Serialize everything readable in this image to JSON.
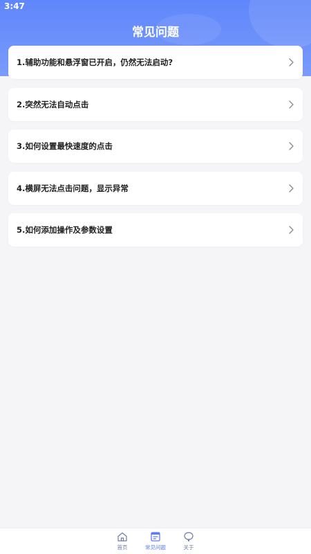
{
  "status_bar": {
    "time": "3:47"
  },
  "header": {
    "title": "常见问题"
  },
  "faq": [
    {
      "label": "1.辅助功能和悬浮窗已开启，仍然无法启动?"
    },
    {
      "label": "2.突然无法自动点击"
    },
    {
      "label": "3.如何设置最快速度的点击"
    },
    {
      "label": "4.横屏无法点击问题，显示异常"
    },
    {
      "label": "5.如何添加操作及参数设置"
    }
  ],
  "tabbar": {
    "tabs": [
      {
        "label": "首页",
        "icon": "home-icon"
      },
      {
        "label": "常见问题",
        "icon": "faq-icon",
        "active": true
      },
      {
        "label": "关于",
        "icon": "chat-bubble-icon"
      }
    ]
  },
  "colors": {
    "header_gradient_top": "#5f86fb",
    "header_gradient_bottom": "#7a9bfb",
    "active_tab": "#5b7df0",
    "background": "#f5f5f7"
  }
}
